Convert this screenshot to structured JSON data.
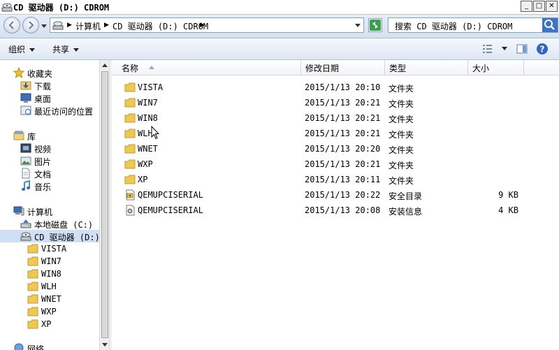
{
  "window": {
    "title": "CD 驱动器 (D:) CDROM",
    "controls": [
      "_",
      "□",
      "✕"
    ]
  },
  "address": {
    "crumbs": [
      "计算机",
      "CD 驱动器 (D:) CDROM"
    ]
  },
  "search": {
    "placeholder": "搜索 CD 驱动器 (D:) CDROM"
  },
  "toolbar": {
    "organize": "组织",
    "share": "共享"
  },
  "nav": {
    "favorites": "收藏夹",
    "downloads": "下载",
    "desktop": "桌面",
    "recent": "最近访问的位置",
    "libraries": "库",
    "videos": "视频",
    "pictures": "图片",
    "documents": "文档",
    "music": "音乐",
    "computer": "计算机",
    "local_disk": "本地磁盘 (C:)",
    "cd_drive": "CD 驱动器 (D:)",
    "subfolders": [
      "VISTA",
      "WIN7",
      "WIN8",
      "WLH",
      "WNET",
      "WXP",
      "XP"
    ],
    "network": "网络"
  },
  "columns": {
    "name": "名称",
    "date": "修改日期",
    "type": "类型",
    "size": "大小"
  },
  "files": [
    {
      "name": "VISTA",
      "date": "2015/1/13 20:10",
      "type": "文件夹",
      "size": "",
      "icon": "folder-icon"
    },
    {
      "name": "WIN7",
      "date": "2015/1/13 20:21",
      "type": "文件夹",
      "size": "",
      "icon": "folder-icon"
    },
    {
      "name": "WIN8",
      "date": "2015/1/13 20:21",
      "type": "文件夹",
      "size": "",
      "icon": "folder-icon"
    },
    {
      "name": "WLH",
      "date": "2015/1/13 20:21",
      "type": "文件夹",
      "size": "",
      "icon": "folder-icon"
    },
    {
      "name": "WNET",
      "date": "2015/1/13 20:20",
      "type": "文件夹",
      "size": "",
      "icon": "folder-icon"
    },
    {
      "name": "WXP",
      "date": "2015/1/13 20:21",
      "type": "文件夹",
      "size": "",
      "icon": "folder-icon"
    },
    {
      "name": "XP",
      "date": "2015/1/13 20:11",
      "type": "文件夹",
      "size": "",
      "icon": "folder-icon"
    },
    {
      "name": "QEMUPCISERIAL",
      "date": "2015/1/13 20:22",
      "type": "安全目录",
      "size": "9 KB",
      "icon": "security-catalog-icon"
    },
    {
      "name": "QEMUPCISERIAL",
      "date": "2015/1/13 20:08",
      "type": "安装信息",
      "size": "4 KB",
      "icon": "setup-info-icon"
    }
  ]
}
